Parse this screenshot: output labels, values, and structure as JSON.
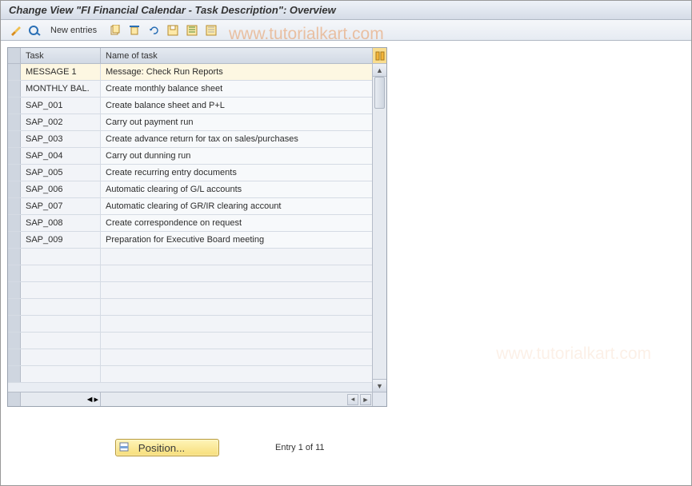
{
  "title": "Change View \"FI Financial Calendar - Task Description\": Overview",
  "toolbar": {
    "new_entries": "New entries"
  },
  "table": {
    "headers": {
      "task": "Task",
      "name": "Name of task"
    },
    "rows": [
      {
        "task": "MESSAGE 1",
        "name": "Message: Check Run Reports"
      },
      {
        "task": "MONTHLY BAL.",
        "name": "Create monthly balance sheet"
      },
      {
        "task": "SAP_001",
        "name": "Create balance sheet and P+L"
      },
      {
        "task": "SAP_002",
        "name": "Carry out payment run"
      },
      {
        "task": "SAP_003",
        "name": "Create advance return for tax on sales/purchases"
      },
      {
        "task": "SAP_004",
        "name": "Carry out dunning run"
      },
      {
        "task": "SAP_005",
        "name": "Create recurring entry documents"
      },
      {
        "task": "SAP_006",
        "name": "Automatic clearing of G/L accounts"
      },
      {
        "task": "SAP_007",
        "name": "Automatic clearing of GR/IR clearing account"
      },
      {
        "task": "SAP_008",
        "name": "Create correspondence on request"
      },
      {
        "task": "SAP_009",
        "name": "Preparation for Executive Board meeting"
      }
    ],
    "empty_rows": 8
  },
  "footer": {
    "position_label": "Position...",
    "entry_text": "Entry 1 of 11"
  },
  "watermark": "www.tutorialkart.com"
}
